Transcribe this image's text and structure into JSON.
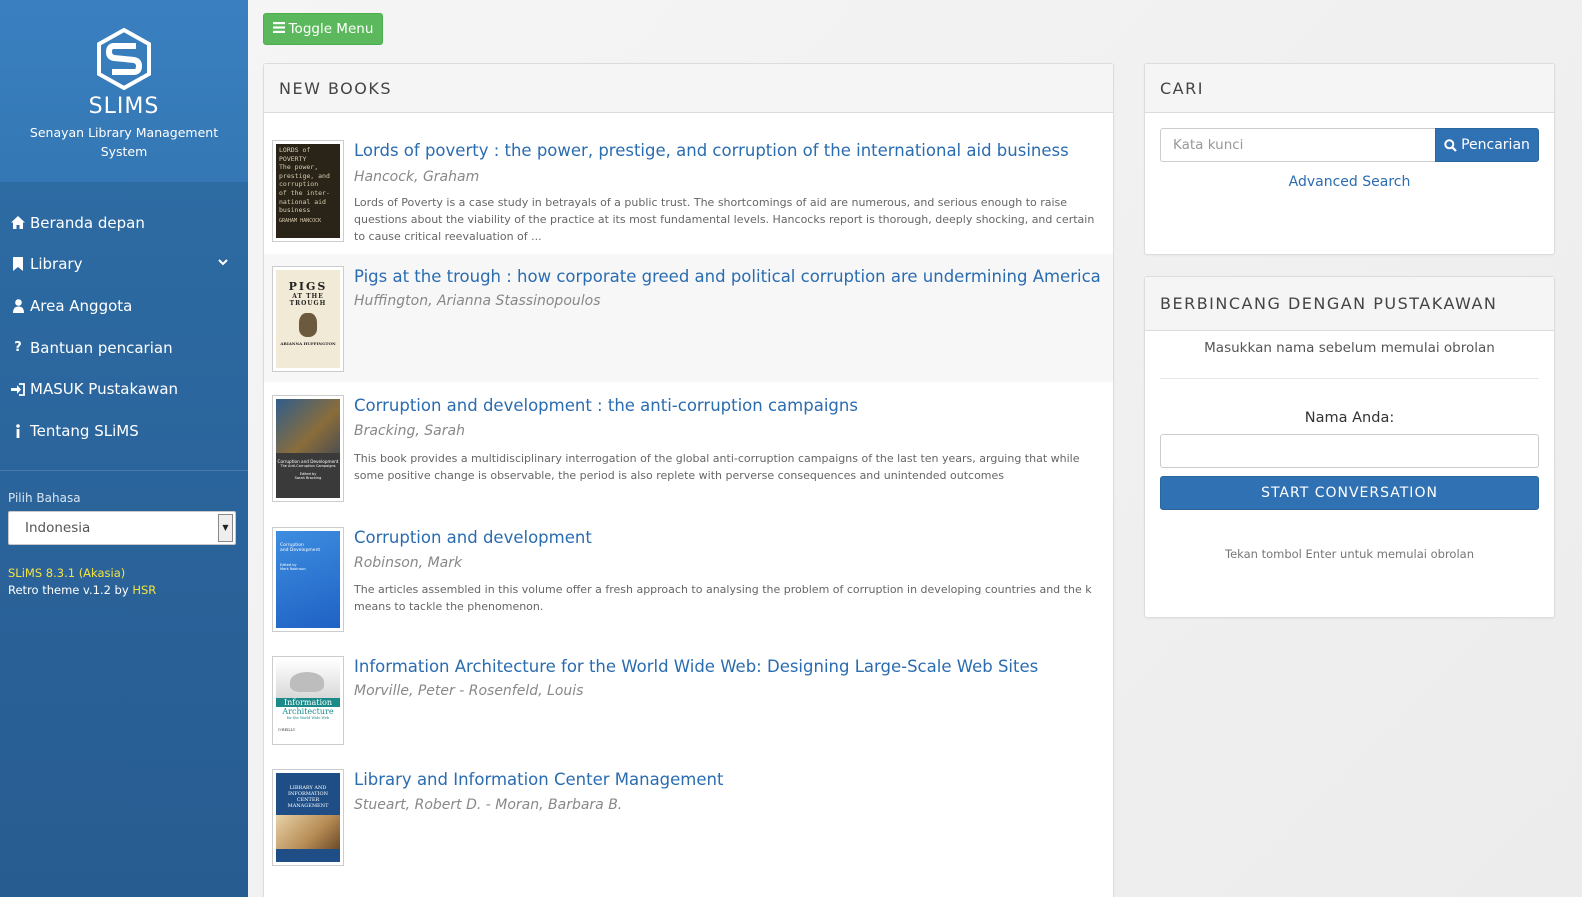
{
  "sidebar": {
    "brand_title": "SLIMS",
    "brand_subtitle": "Senayan Library Management System",
    "nav": [
      {
        "label": "Beranda depan",
        "icon": "home-icon"
      },
      {
        "label": "Library",
        "icon": "bookmark-icon"
      },
      {
        "label": "Area Anggota",
        "icon": "user-icon"
      },
      {
        "label": "Bantuan pencarian",
        "icon": "question-icon"
      },
      {
        "label": "MASUK Pustakawan",
        "icon": "sign-in-icon"
      },
      {
        "label": "Tentang SLiMS",
        "icon": "info-icon"
      }
    ],
    "language_label": "Pilih Bahasa",
    "language_selected": "Indonesia",
    "version_line": "SLiMS 8.3.1 (Akasia)",
    "theme_prefix": "Retro theme v.1.2 by ",
    "theme_author": "HSR"
  },
  "toolbar": {
    "toggle_label": "Toggle Menu"
  },
  "new_books": {
    "heading": "NEW BOOKS",
    "items": [
      {
        "title": "Lords of poverty : the power, prestige, and corruption of the international aid business",
        "author": "Hancock, Graham",
        "description": "Lords of Poverty is a case study in betrayals of a public trust. The shortcomings of aid are numerous, and serious enough to raise questions about the viability of the practice at its most fundamental levels. Hancocks report is thorough, deeply shocking, and certain to cause critical reevaluation of ...",
        "cover_text": [
          "LORDS of",
          "POVERTY",
          "The power,",
          "prestige, and",
          "corruption",
          "of the inter-",
          "national aid",
          "business",
          "GRAHAM HANCOCK"
        ]
      },
      {
        "title": "Pigs at the trough : how corporate greed and political corruption are undermining America",
        "author": "Huffington, Arianna Stassinopoulos",
        "description": "",
        "cover_text": [
          "PIGS",
          "AT THE",
          "TROUGH",
          "ARIANNA HUFFINGTON"
        ]
      },
      {
        "title": "Corruption and development : the anti-corruption campaigns",
        "author": "Bracking, Sarah",
        "description": "This book provides a multidisciplinary interrogation of the global anti-corruption campaigns of the last ten years, arguing that while some positive change is observable, the period is also replete with perverse consequences and unintended outcomes",
        "cover_text": [
          "Corruption and Development",
          "The Anti-Corruption Campaigns",
          "Edited by",
          "Sarah Bracking"
        ]
      },
      {
        "title": "Corruption and development",
        "author": "Robinson, Mark",
        "description": "The articles assembled in this volume offer a fresh approach to analysing the problem of corruption in developing countries and the k means to tackle the phenomenon.",
        "cover_text": [
          "Corruption",
          "and Development",
          "Edited by",
          "Mark Robinson"
        ]
      },
      {
        "title": "Information Architecture for the World Wide Web: Designing Large-Scale Web Sites",
        "author": "Morville, Peter - Rosenfeld, Louis",
        "description": "",
        "cover_text": [
          "Information",
          "Architecture",
          "for the World Wide Web",
          "O'REILLY"
        ]
      },
      {
        "title": "Library and Information Center Management",
        "author": "Stueart, Robert D. - Moran, Barbara B.",
        "description": "",
        "cover_text": [
          "LIBRARY AND",
          "INFORMATION",
          "CENTER",
          "MANAGEMENT"
        ]
      }
    ]
  },
  "search": {
    "heading": "CARI",
    "placeholder": "Kata kunci",
    "button_label": "Pencarian",
    "advanced_label": "Advanced Search"
  },
  "chat": {
    "heading": "BERBINCANG DENGAN PUSTAKAWAN",
    "note": "Masukkan nama sebelum memulai obrolan",
    "name_label": "Nama Anda:",
    "button_label": "START CONVERSATION",
    "hint": "Tekan tombol Enter untuk memulai obrolan"
  },
  "colors": {
    "sidebar": "#2a639a",
    "link": "#2a6cb0",
    "primary_button": "#2f71b3",
    "toggle_button": "#5cb85c",
    "version_highlight": "#f5e342"
  }
}
